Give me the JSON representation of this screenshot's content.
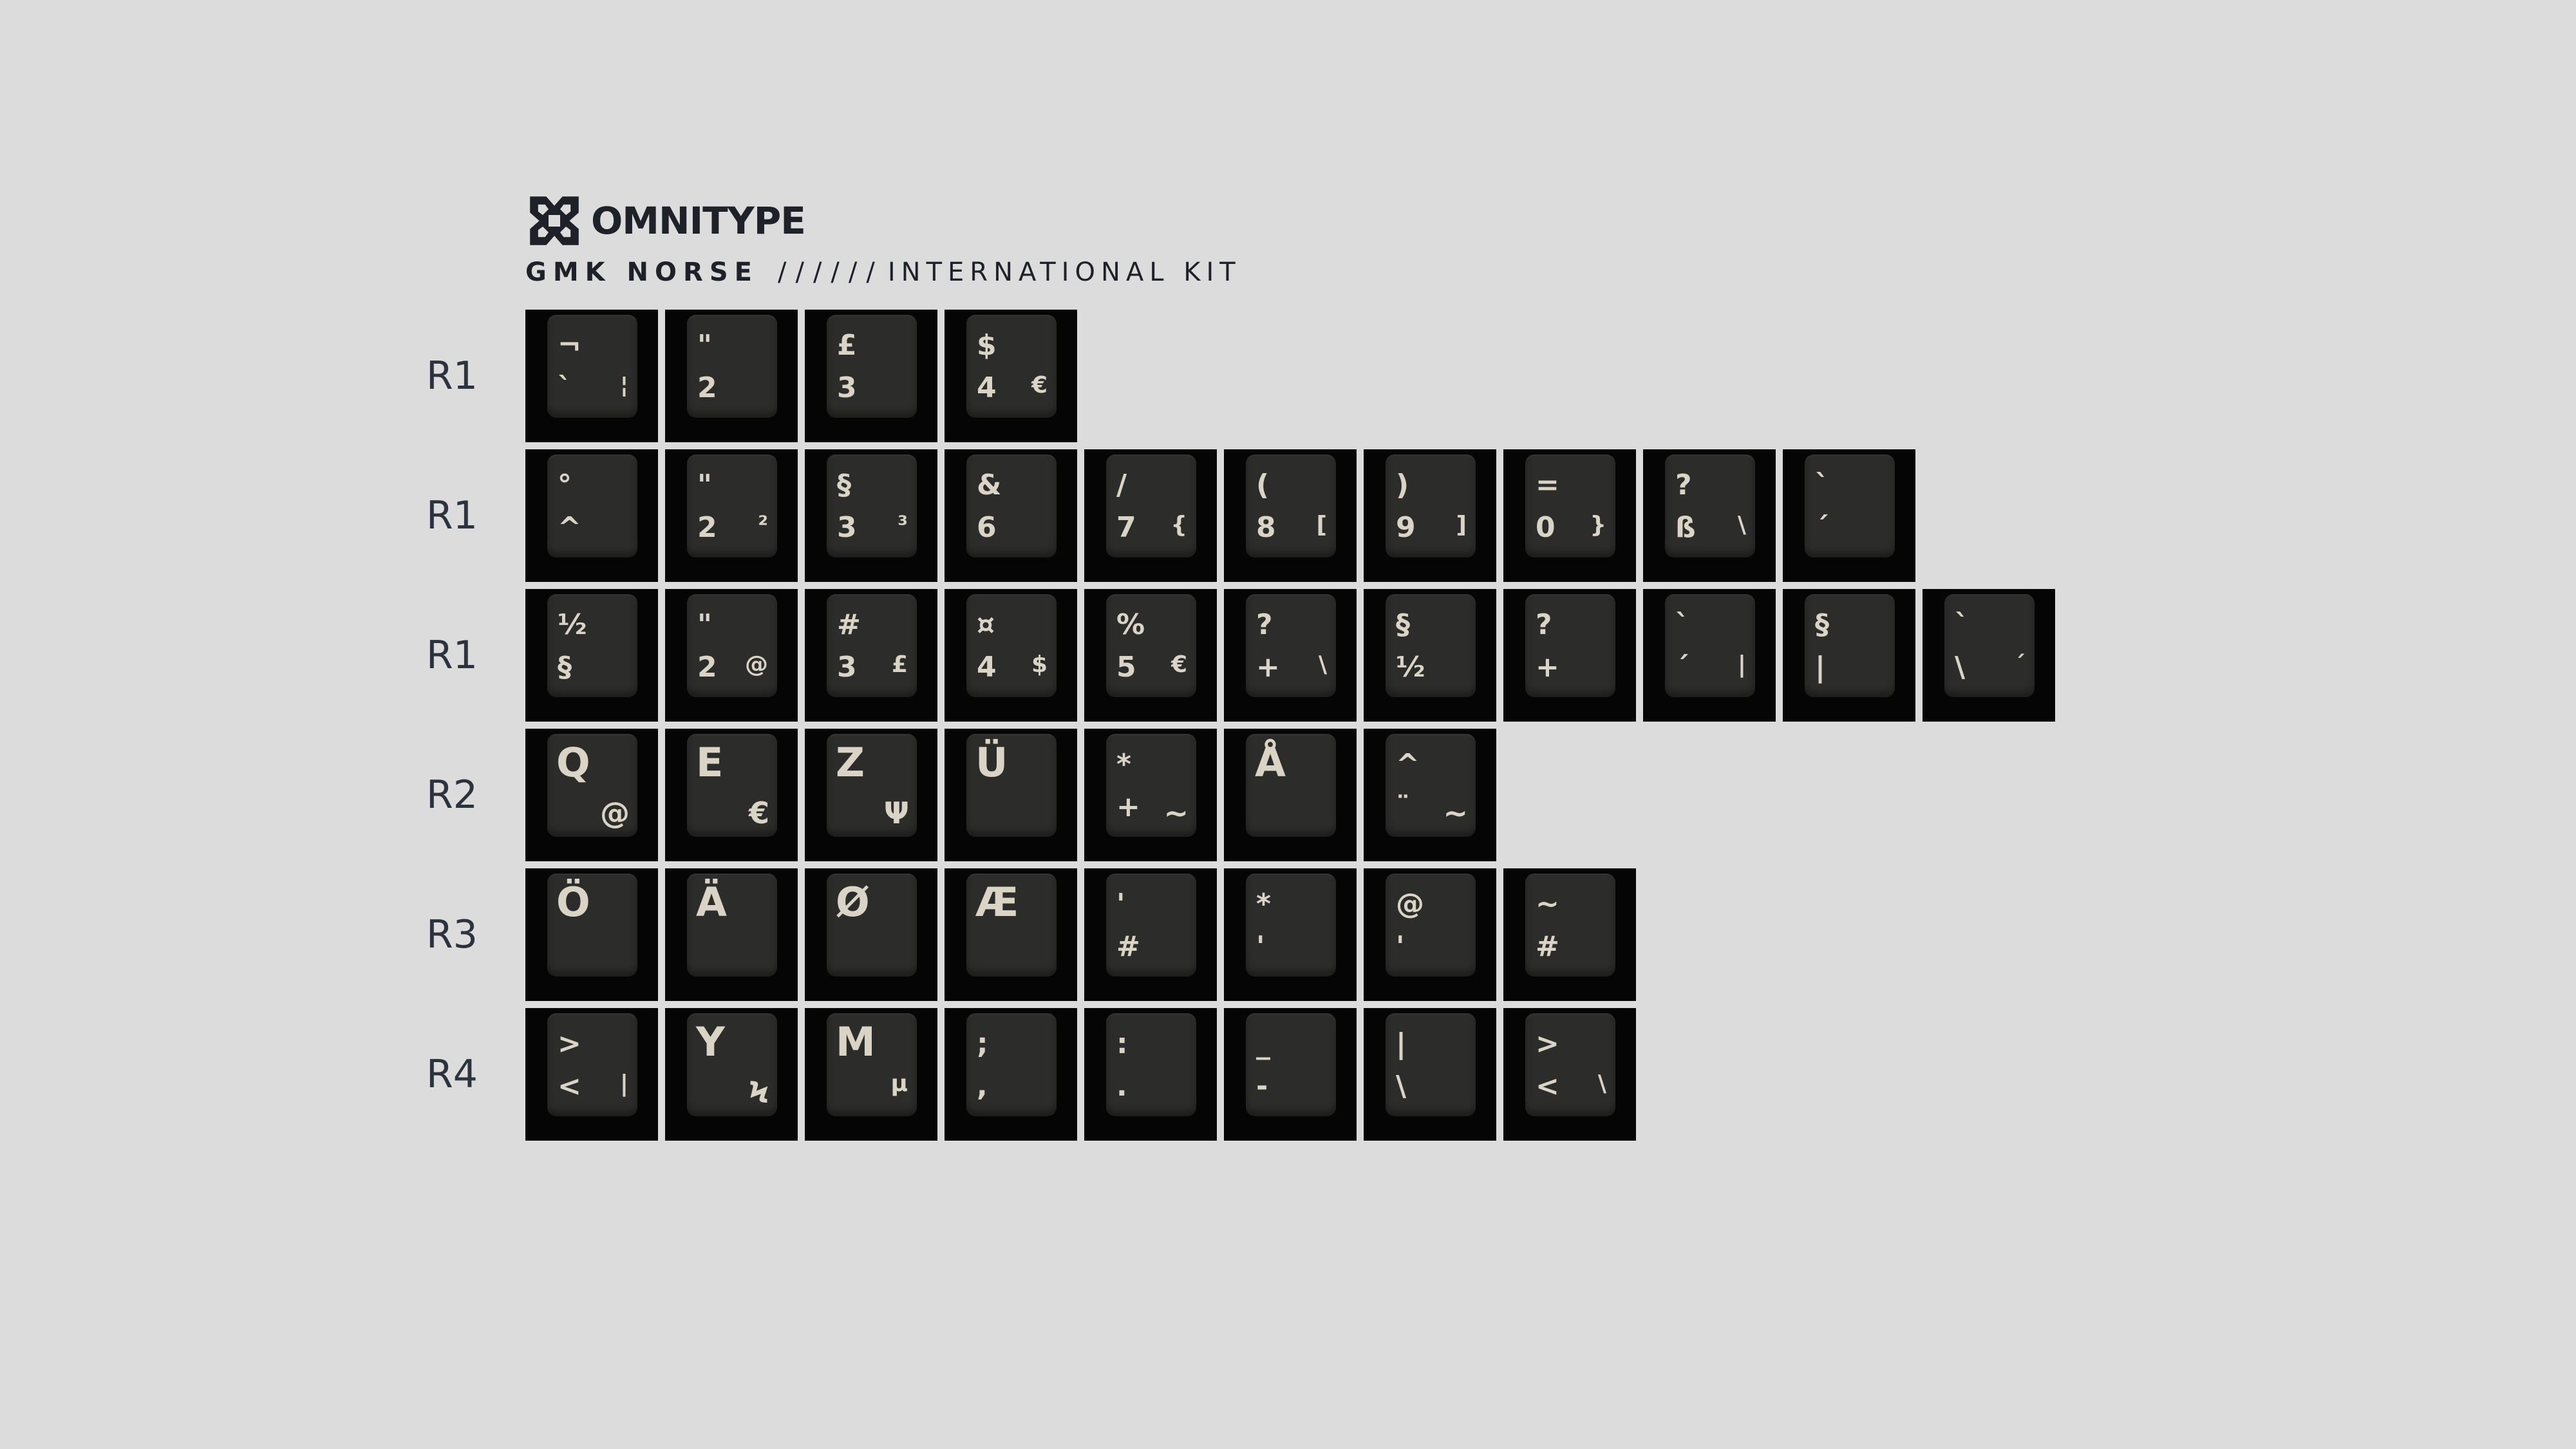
{
  "brand": {
    "name": "OMNITYPE",
    "product": "GMK NORSE",
    "separator": "//////",
    "kit": "INTERNATIONAL KIT"
  },
  "colors": {
    "background": "#dcdcdc",
    "key_base": "#050505",
    "key_top": "#2c2c2b",
    "legend": "#d9d4c5",
    "text": "#1e2228"
  },
  "rows": [
    {
      "label": "R1",
      "keys": [
        {
          "tl": "¬",
          "bl": "`",
          "br": "¦"
        },
        {
          "tl": "\"",
          "bl": "2",
          "br": ""
        },
        {
          "tl": "£",
          "bl": "3",
          "br": ""
        },
        {
          "tl": "$",
          "bl": "4",
          "br": "€"
        }
      ]
    },
    {
      "label": "R1",
      "keys": [
        {
          "tl": "°",
          "bl": "^",
          "br": ""
        },
        {
          "tl": "\"",
          "bl": "2",
          "br": "²"
        },
        {
          "tl": "§",
          "bl": "3",
          "br": "³"
        },
        {
          "tl": "&",
          "bl": "6",
          "br": ""
        },
        {
          "tl": "/",
          "bl": "7",
          "br": "{"
        },
        {
          "tl": "(",
          "bl": "8",
          "br": "["
        },
        {
          "tl": ")",
          "bl": "9",
          "br": "]"
        },
        {
          "tl": "=",
          "bl": "0",
          "br": "}"
        },
        {
          "tl": "?",
          "bl": "ß",
          "br": "\\"
        },
        {
          "tl": "`",
          "bl": "´",
          "br": ""
        }
      ]
    },
    {
      "label": "R1",
      "keys": [
        {
          "tl": "½",
          "bl": "§",
          "br": ""
        },
        {
          "tl": "\"",
          "bl": "2",
          "br": "@"
        },
        {
          "tl": "#",
          "bl": "3",
          "br": "£"
        },
        {
          "tl": "¤",
          "bl": "4",
          "br": "$"
        },
        {
          "tl": "%",
          "bl": "5",
          "br": "€"
        },
        {
          "tl": "?",
          "bl": "+",
          "br": "\\"
        },
        {
          "tl": "§",
          "bl": "½",
          "br": ""
        },
        {
          "tl": "?",
          "bl": "+",
          "br": ""
        },
        {
          "tl": "`",
          "bl": "´",
          "br": "|"
        },
        {
          "tl": "§",
          "bl": "|",
          "br": ""
        },
        {
          "tl": "`",
          "bl": "\\",
          "br": "´"
        }
      ]
    },
    {
      "label": "R2",
      "keys": [
        {
          "big": "Q",
          "brb": "@"
        },
        {
          "big": "E",
          "brb": "€"
        },
        {
          "big": "Z",
          "brb": "Ψ"
        },
        {
          "big": "Ü",
          "brb": ""
        },
        {
          "tl": "*",
          "bl": "+",
          "brb": "~"
        },
        {
          "big": "Å",
          "brb": ""
        },
        {
          "tl": "^",
          "bl": "¨",
          "brb": "~"
        }
      ]
    },
    {
      "label": "R3",
      "keys": [
        {
          "big": "Ö",
          "brb": ""
        },
        {
          "big": "Ä",
          "brb": ""
        },
        {
          "big": "Ø",
          "brb": ""
        },
        {
          "big": "Æ",
          "brb": ""
        },
        {
          "tl": "'",
          "bl": "#",
          "brb": ""
        },
        {
          "tl": "*",
          "bl": "'",
          "brb": ""
        },
        {
          "tl": "@",
          "bl": "'",
          "brb": ""
        },
        {
          "tl": "~",
          "bl": "#",
          "brb": ""
        }
      ]
    },
    {
      "label": "R4",
      "keys": [
        {
          "tl": ">",
          "bl": "<",
          "br": "|"
        },
        {
          "big": "Y",
          "brb": "Ϟ"
        },
        {
          "big": "M",
          "br": "µ"
        },
        {
          "tl": ";",
          "bl": ",",
          "br": ""
        },
        {
          "tl": ":",
          "bl": ".",
          "br": ""
        },
        {
          "tl": "_",
          "bl": "-",
          "br": ""
        },
        {
          "tl": "|",
          "bl": "\\",
          "br": ""
        },
        {
          "tl": ">",
          "bl": "<",
          "br": "\\"
        }
      ]
    }
  ]
}
